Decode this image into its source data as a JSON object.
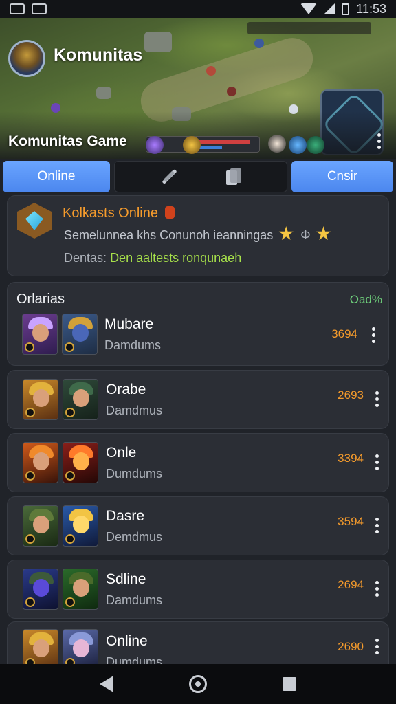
{
  "status_bar": {
    "time": "11:53",
    "icons": [
      "gallery-icon",
      "mail-icon",
      "wifi-icon",
      "signal-icon",
      "battery-icon"
    ]
  },
  "hero": {
    "title": "Komunitas",
    "subtitle": "Komunitas Game",
    "avatar_icon": "hero-avatar",
    "menu_icon": "kebab-icon"
  },
  "tabs": [
    {
      "label": "Online",
      "active": true
    },
    {
      "label": "",
      "icons": [
        "sword-icon",
        "documents-icon"
      ]
    },
    {
      "label": "Cnsir",
      "active": false
    }
  ],
  "featured": {
    "icon": "gem-hexagon-icon",
    "title": "Kolkasts Online",
    "description": "Semelunnea khs Conunoh ieanningas",
    "description_icons": [
      "star-icon",
      "phi-icon",
      "star-icon"
    ],
    "meta_label": "Dentas:",
    "meta_value": "Den aaltests ronqunaeh"
  },
  "list": {
    "title": "Orlarias",
    "meta": "Oad%",
    "rows": [
      {
        "name": "Mubare",
        "subtitle": "Damdums",
        "score": "3694"
      },
      {
        "name": "Orabe",
        "subtitle": "Damdmus",
        "score": "2693"
      },
      {
        "name": "Onle",
        "subtitle": "Dumdums",
        "score": "3394"
      },
      {
        "name": "Dasre",
        "subtitle": "Demdmus",
        "score": "3594"
      },
      {
        "name": "Sdline",
        "subtitle": "Damdums",
        "score": "2694"
      },
      {
        "name": "Online",
        "subtitle": "Dumdums",
        "score": "2690"
      }
    ]
  },
  "colors": {
    "accent": "#5a95f7",
    "orange": "#f59b2c",
    "green": "#a6e04a",
    "card": "#2b2e35"
  }
}
